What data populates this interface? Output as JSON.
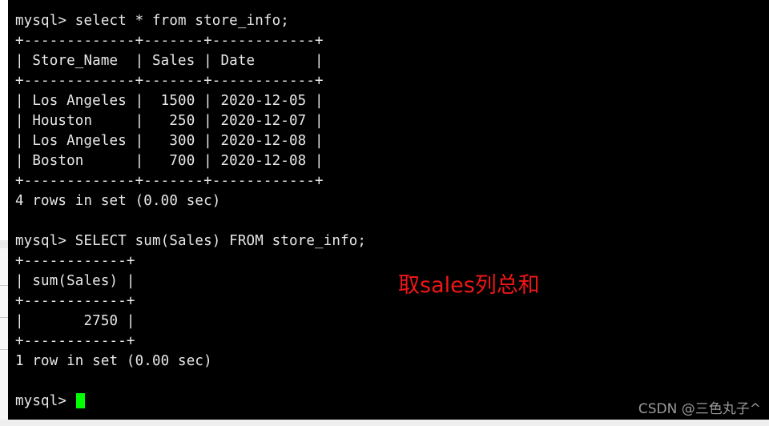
{
  "window": {
    "kind": "terminal",
    "background_color": "#000000",
    "foreground_color": "#e8e8e8",
    "page_background_color": "#f4f4f4"
  },
  "terminal": {
    "lines": [
      {
        "id": "cmd-1",
        "text": "mysql> select * from store_info;"
      },
      {
        "id": "t1-rule-top",
        "text": "+-------------+-------+------------+"
      },
      {
        "id": "t1-header",
        "text": "| Store_Name  | Sales | Date       |"
      },
      {
        "id": "t1-rule-mid",
        "text": "+-------------+-------+------------+"
      },
      {
        "id": "t1-row-1",
        "text": "| Los Angeles |  1500 | 2020-12-05 |"
      },
      {
        "id": "t1-row-2",
        "text": "| Houston     |   250 | 2020-12-07 |"
      },
      {
        "id": "t1-row-3",
        "text": "| Los Angeles |   300 | 2020-12-08 |"
      },
      {
        "id": "t1-row-4",
        "text": "| Boston      |   700 | 2020-12-08 |"
      },
      {
        "id": "t1-rule-bot",
        "text": "+-------------+-------+------------+"
      },
      {
        "id": "t1-status",
        "text": "4 rows in set (0.00 sec)"
      },
      {
        "id": "blank-1",
        "text": ""
      },
      {
        "id": "cmd-2",
        "text": "mysql> SELECT sum(Sales) FROM store_info;"
      },
      {
        "id": "t2-rule-top",
        "text": "+------------+"
      },
      {
        "id": "t2-header",
        "text": "| sum(Sales) |"
      },
      {
        "id": "t2-rule-mid",
        "text": "+------------+"
      },
      {
        "id": "t2-row-1",
        "text": "|       2750 |"
      },
      {
        "id": "t2-rule-bot",
        "text": "+------------+"
      },
      {
        "id": "t2-status",
        "text": "1 row in set (0.00 sec)"
      },
      {
        "id": "blank-2",
        "text": ""
      }
    ],
    "final_prompt": "mysql> ",
    "cursor_color": "#00ff00"
  },
  "annotation": {
    "text": "取sales列总和",
    "color": "#f01616"
  },
  "watermark": {
    "text": "CSDN @三色丸子^",
    "color": "#9a9a9a"
  },
  "table_data": {
    "query_1": {
      "sql": "select * from store_info;",
      "columns": [
        "Store_Name",
        "Sales",
        "Date"
      ],
      "rows": [
        [
          "Los Angeles",
          "1500",
          "2020-12-05"
        ],
        [
          "Houston",
          "250",
          "2020-12-07"
        ],
        [
          "Los Angeles",
          "300",
          "2020-12-08"
        ],
        [
          "Boston",
          "700",
          "2020-12-08"
        ]
      ],
      "status": "4 rows in set (0.00 sec)"
    },
    "query_2": {
      "sql": "SELECT sum(Sales) FROM store_info;",
      "columns": [
        "sum(Sales)"
      ],
      "rows": [
        [
          "2750"
        ]
      ],
      "status": "1 row in set (0.00 sec)"
    }
  }
}
